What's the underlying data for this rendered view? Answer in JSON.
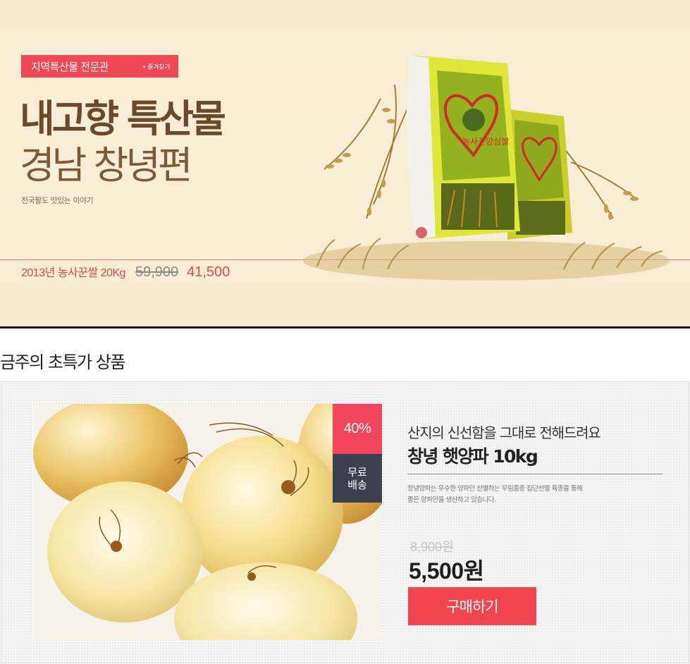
{
  "hero": {
    "badge_label": "지역특산물 전문관",
    "favorite_label": "+ 즐겨찾기",
    "title_line1": "내고향 특산물",
    "title_line2": "경남 창녕편",
    "subtitle": "전국팔도 맛있는 이야기",
    "product_name": "2013년 농사꾼쌀 20Kg",
    "original_price": "59,900",
    "sale_price": "41,500",
    "package_text": "농사꾼양심쌀"
  },
  "deal": {
    "section_title": "금주의 초특가 상품",
    "discount_badge": "40%",
    "shipping_badge_line1": "무료",
    "shipping_badge_line2": "배송",
    "headline": "산지의 신선함을 그대로 전해드려요",
    "product_name": "창녕 햇양파 10kg",
    "description_line1": "창녕양파는 우수한 양파만 선별하는 우림품종 집단선별 육종을 통해",
    "description_line2": "좋은 양파만을 생산하고 있습니다.",
    "original_price": "8,900원",
    "sale_price": "5,500원",
    "buy_label": "구매하기"
  },
  "colors": {
    "accent_red": "#f2454f",
    "hero_brown": "#6b4a2c",
    "hero_bg": "#f7ecd3",
    "dark_badge": "#3c4150"
  }
}
